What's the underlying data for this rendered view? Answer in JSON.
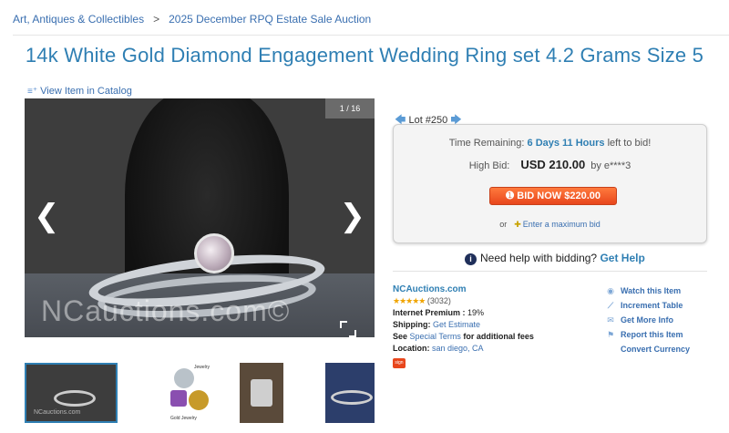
{
  "breadcrumb": {
    "items": [
      "Art, Antiques & Collectibles",
      "2025 December RPQ Estate Sale Auction"
    ],
    "separator": ">"
  },
  "title": "14k White Gold Diamond Engagement Wedding Ring set 4.2 Grams Size 5",
  "catalog_link": "View Item in Catalog",
  "gallery": {
    "counter": "1 / 16",
    "watermark": "NCauctions.com©",
    "thumb_watermark": "NCauctions.com",
    "thumb_label_2": "Jewelry",
    "thumb_caption_2": "Gold Jewelry"
  },
  "lot": {
    "label": "Lot #250"
  },
  "bid_box": {
    "time_label": "Time Remaining:",
    "time_value": "6 Days 11 Hours",
    "time_suffix": "left to bid!",
    "high_bid_label": "High Bid:",
    "high_bid_amount": "USD 210.00",
    "high_bid_by": "by e****3",
    "bid_button": "BID NOW $220.00",
    "or_text": "or",
    "max_bid_link": "Enter a maximum bid"
  },
  "help": {
    "text": "Need help with bidding?",
    "link": "Get Help"
  },
  "seller": {
    "name": "NCAuctions.com",
    "stars": "★★★★★",
    "rating_count": "(3032)",
    "premium_label": "Internet Premium :",
    "premium_value": "19%",
    "shipping_label": "Shipping:",
    "shipping_link": "Get Estimate",
    "see_text": "See",
    "terms_link": "Special Terms",
    "terms_suffix": "for additional fees",
    "location_label": "Location:",
    "location_value": "san diego, CA",
    "logo_text": "sign"
  },
  "actions": [
    "Watch this Item",
    "Increment Table",
    "Get More Info",
    "Report this Item",
    "Convert Currency"
  ],
  "colors": {
    "link": "#3a6fb0",
    "title": "#2f7fb3",
    "bid_button": "#e8461c",
    "stars": "#f0a400"
  }
}
